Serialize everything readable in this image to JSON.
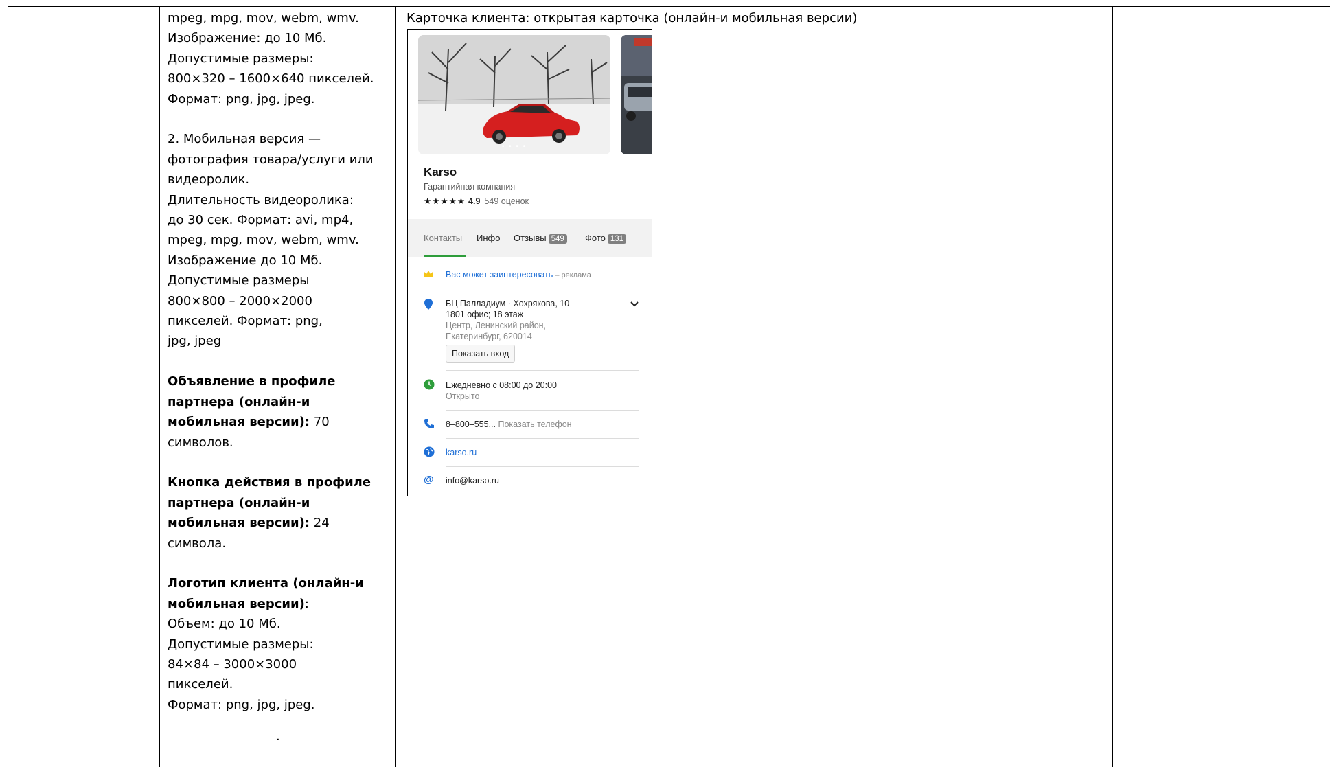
{
  "requirements_column": {
    "lines_part1": [
      "mpeg, mpg, mov, webm, wmv.",
      "Изображение: до 10 Мб.",
      "Допустимые размеры:",
      "800×320 – 1600×640 пикселей.",
      "Формат: png, jpg, jpeg."
    ],
    "lines_part2": [
      "2. Мобильная версия —",
      "фотография товара/услуги или",
      "видеоролик.",
      "Длительность видеоролика:",
      "до 30 сек. Формат: avi, mp4,",
      "mpeg, mpg, mov, webm, wmv.",
      "Изображение до 10 Мб.",
      "Допустимые размеры",
      "800×800 – 2000×2000",
      "пикселей. Формат: png,",
      "jpg, jpeg"
    ],
    "ad_profile": {
      "bold_lines": [
        "Объявление в профиле",
        "партнера (онлайн-и",
        "мобильная версии):"
      ],
      "value_a": " 70",
      "value_b": "символов."
    },
    "action_button": {
      "bold_lines": [
        "Кнопка действия в профиле",
        "партнера (онлайн-и",
        "мобильная версии):"
      ],
      "value_a": " 24",
      "value_b": "символа."
    },
    "logo": {
      "bold_lines": [
        "Логотип клиента (онлайн-и",
        "мобильная версии)"
      ],
      "colon": ":",
      "lines": [
        "Объем: до 10 Мб.",
        "Допустимые размеры:",
        "84×84 – 3000×3000",
        "пикселей.",
        "Формат: png, jpg, jpeg."
      ]
    },
    "trailing_dot": "."
  },
  "example_column": {
    "title": "Карточка клиента: открытая карточка (онлайн-и мобильная версии)"
  },
  "card": {
    "photo_dots": "• • • •",
    "name": "Karso",
    "category": "Гарантийная компания",
    "stars": "★★★★★",
    "rating": "4.9",
    "reviews_count": "549 оценок",
    "tabs": {
      "contacts": "Контакты",
      "info": "Инфо",
      "reviews": "Отзывы",
      "reviews_badge": "549",
      "photos": "Фото",
      "photos_badge": "131"
    },
    "promo": {
      "link": "Вас может заинтересовать",
      "suffix": " – реклама"
    },
    "address": {
      "building": "БЦ Палладиум",
      "separator": " · ",
      "street": "Хохрякова, 10",
      "office": "1801 офис; 18 этаж",
      "district": "Центр, Ленинский район,",
      "city": "Екатеринбург, 620014",
      "entrance_button": "Показать вход"
    },
    "hours": {
      "schedule": "Ежедневно с 08:00 до 20:00",
      "status": "Открыто"
    },
    "phone": {
      "number": "8–800–555...",
      "show": " Показать телефон"
    },
    "website": "karso.ru",
    "email": "info@karso.ru",
    "colors": {
      "accent_green": "#2e9d3b",
      "link_blue": "#1f6fd6",
      "promo_yellow": "#f5c518"
    }
  }
}
